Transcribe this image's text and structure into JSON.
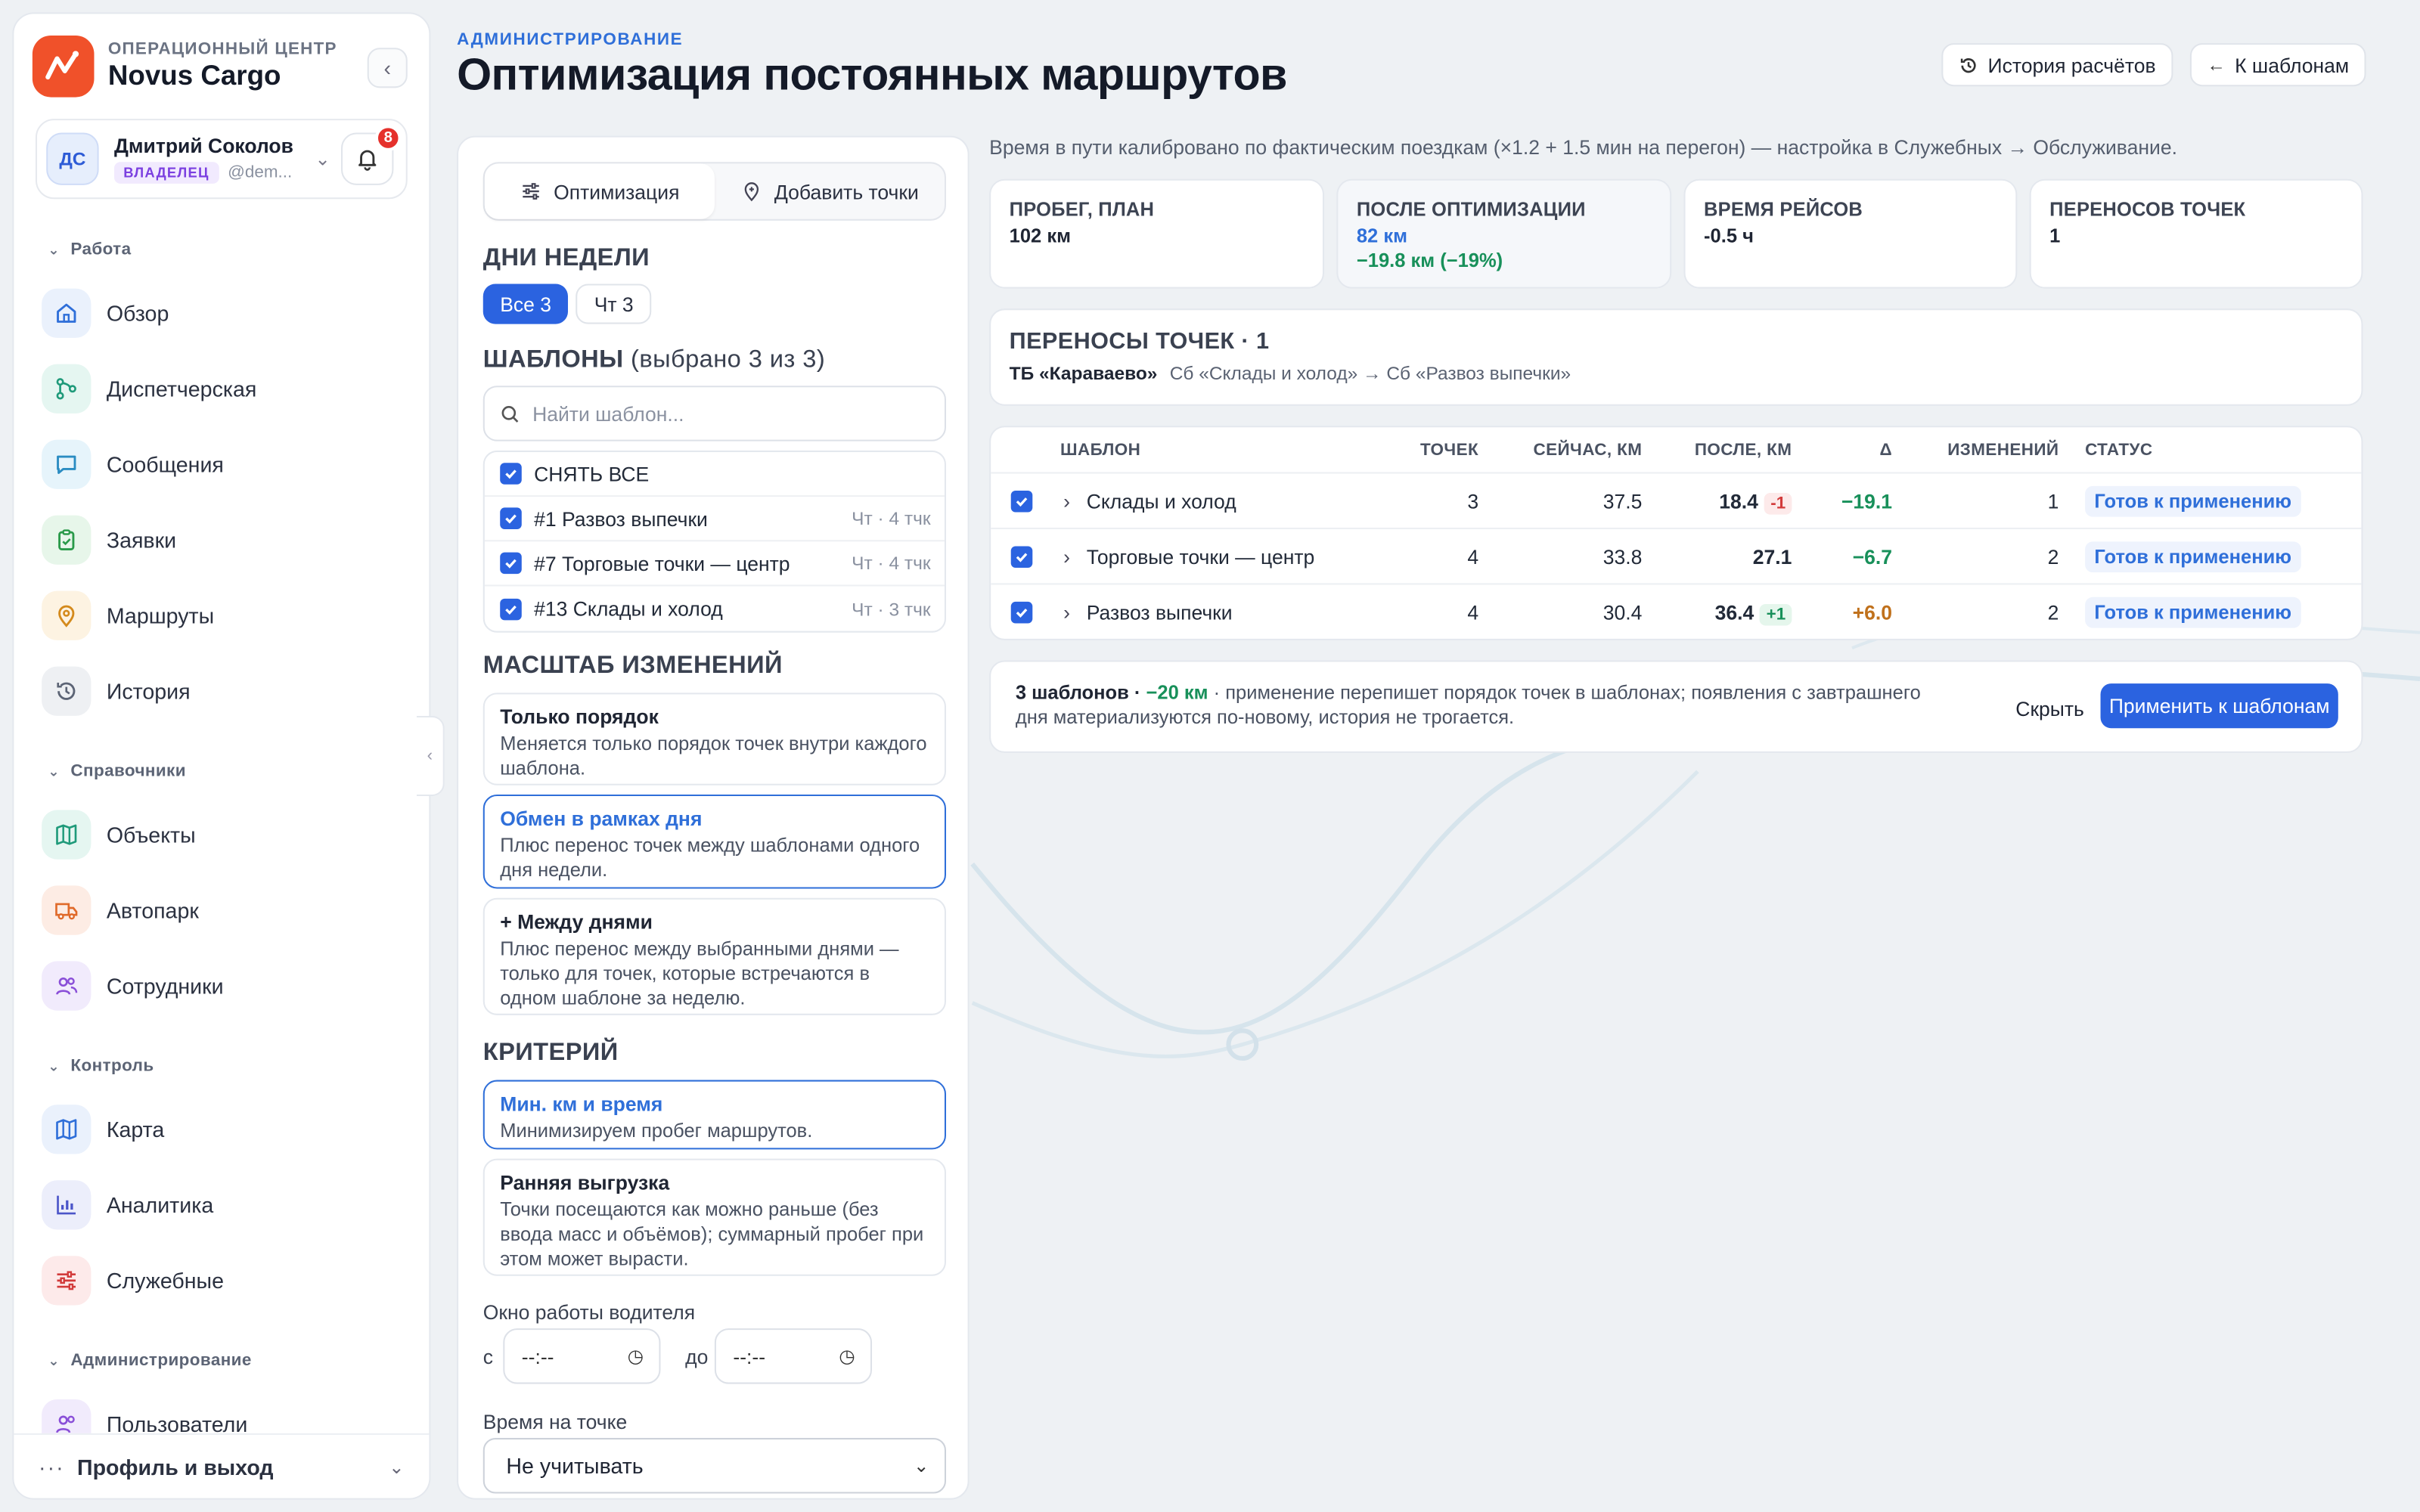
{
  "brand": {
    "sub": "ОПЕРАЦИОННЫЙ ЦЕНТР",
    "name": "Novus Cargo"
  },
  "user": {
    "initials": "ДС",
    "name": "Дмитрий Соколов",
    "role": "ВЛАДЕЛЕЦ",
    "handle": "@dem...",
    "notifications": "8"
  },
  "nav": {
    "sections": [
      {
        "title": "Работа",
        "items": [
          {
            "label": "Обзор",
            "icon": "home-icon"
          },
          {
            "label": "Диспетчерская",
            "icon": "route-icon"
          },
          {
            "label": "Сообщения",
            "icon": "message-icon"
          },
          {
            "label": "Заявки",
            "icon": "clipboard-icon"
          },
          {
            "label": "Маршруты",
            "icon": "pin-icon"
          },
          {
            "label": "История",
            "icon": "history-icon"
          }
        ]
      },
      {
        "title": "Справочники",
        "items": [
          {
            "label": "Объекты",
            "icon": "map-icon"
          },
          {
            "label": "Автопарк",
            "icon": "truck-icon"
          },
          {
            "label": "Сотрудники",
            "icon": "users-icon"
          }
        ]
      },
      {
        "title": "Контроль",
        "items": [
          {
            "label": "Карта",
            "icon": "map-icon"
          },
          {
            "label": "Аналитика",
            "icon": "chart-icon"
          },
          {
            "label": "Служебные",
            "icon": "sliders-icon"
          }
        ]
      },
      {
        "title": "Администрирование",
        "items": [
          {
            "label": "Пользователи",
            "icon": "users-icon"
          }
        ]
      }
    ],
    "footer": "Профиль и выход"
  },
  "header": {
    "eyebrow": "АДМИНИСТРИРОВАНИЕ",
    "title": "Оптимизация постоянных маршрутов",
    "history_btn": "История расчётов",
    "back_btn": "К шаблонам"
  },
  "panel": {
    "tabs": [
      "Оптимизация",
      "Добавить точки"
    ],
    "days_title": "ДНИ НЕДЕЛИ",
    "day_chips": [
      "Все 3",
      "Чт 3"
    ],
    "templates_title": "ШАБЛОНЫ",
    "templates_count": "(выбрано 3 из 3)",
    "search_placeholder": "Найти шаблон...",
    "uncheck_all": "СНЯТЬ ВСЕ",
    "templates": [
      {
        "name": "#1 Развоз выпечки",
        "meta": "Чт · 4 тчк"
      },
      {
        "name": "#7 Торговые точки — центр",
        "meta": "Чт · 4 тчк"
      },
      {
        "name": "#13 Склады и холод",
        "meta": "Чт · 3 тчк"
      }
    ],
    "scope_title": "МАСШТАБ ИЗМЕНЕНИЙ",
    "scope_options": [
      {
        "title": "Только порядок",
        "desc": "Меняется только порядок точек внутри каждого шаблона."
      },
      {
        "title": "Обмен в рамках дня",
        "desc": "Плюс перенос точек между шаблонами одного дня недели."
      },
      {
        "title": "+ Между днями",
        "desc": "Плюс перенос между выбранными днями — только для точек, которые встречаются в одном шаблоне за неделю."
      }
    ],
    "criterion_title": "КРИТЕРИЙ",
    "criterion_options": [
      {
        "title": "Мин. км и время",
        "desc": "Минимизируем пробег маршрутов."
      },
      {
        "title": "Ранняя выгрузка",
        "desc": "Точки посещаются как можно раньше (без ввода масс и объёмов); суммарный пробег при этом может вырасти."
      }
    ],
    "driver_window_label": "Окно работы водителя",
    "from_label": "с",
    "to_label": "до",
    "time_value": "--:--",
    "stop_time_label": "Время на точке",
    "stop_time_value": "Не учитывать"
  },
  "calibration": "Время в пути калибровано по фактическим поездкам (×1.2 + 1.5 мин на перегон) — настройка в Служебных → Обслуживание.",
  "kpis": [
    {
      "label": "ПРОБЕГ, ПЛАН",
      "value": "102 км",
      "value2": ""
    },
    {
      "label": "ПОСЛЕ ОПТИМИЗАЦИИ",
      "value": "82 км",
      "value2": "−19.8 км (−19%)"
    },
    {
      "label": "ВРЕМЯ РЕЙСОВ",
      "value": "-0.5 ч",
      "value2": ""
    },
    {
      "label": "ПЕРЕНОСОВ ТОЧЕК",
      "value": "1",
      "value2": ""
    }
  ],
  "moves": {
    "title": "ПЕРЕНОСЫ ТОЧЕК · 1",
    "point": "ТБ «Караваево»",
    "detail": "Сб «Склады и холод» → Сб «Развоз выпечки»"
  },
  "table": {
    "headers": [
      "ШАБЛОН",
      "ТОЧЕК",
      "СЕЙЧАС, КМ",
      "ПОСЛЕ, КМ",
      "Δ",
      "ИЗМЕНЕНИЙ",
      "СТАТУС"
    ],
    "rows": [
      {
        "name": "Склады и холод",
        "points": "3",
        "now": "37.5",
        "after": "18.4",
        "chip": "-1",
        "chip_type": "neg",
        "delta": "−19.1",
        "delta_color": "#18905a",
        "changes": "1",
        "status": "Готов к применению"
      },
      {
        "name": "Торговые точки — центр",
        "points": "4",
        "now": "33.8",
        "after": "27.1",
        "chip": "",
        "chip_type": "",
        "delta": "−6.7",
        "delta_color": "#18905a",
        "changes": "2",
        "status": "Готов к применению"
      },
      {
        "name": "Развоз выпечки",
        "points": "4",
        "now": "30.4",
        "after": "36.4",
        "chip": "+1",
        "chip_type": "pos",
        "delta": "+6.0",
        "delta_color": "#c0711c",
        "changes": "2",
        "status": "Готов к применению"
      }
    ]
  },
  "footer": {
    "summary_bold": "3 шаблонов ·",
    "summary_km": "−20 км",
    "summary_rest": "· применение перепишет порядок точек в шаблонах; появления с завтрашнего дня материализуются по-новому, история не трогается.",
    "hide": "Скрыть",
    "apply": "Применить к шаблонам"
  },
  "colors": {
    "accent": "#2b63e0",
    "brand": "#f0512a",
    "positive": "#18905a",
    "negative": "#d23b3b"
  }
}
